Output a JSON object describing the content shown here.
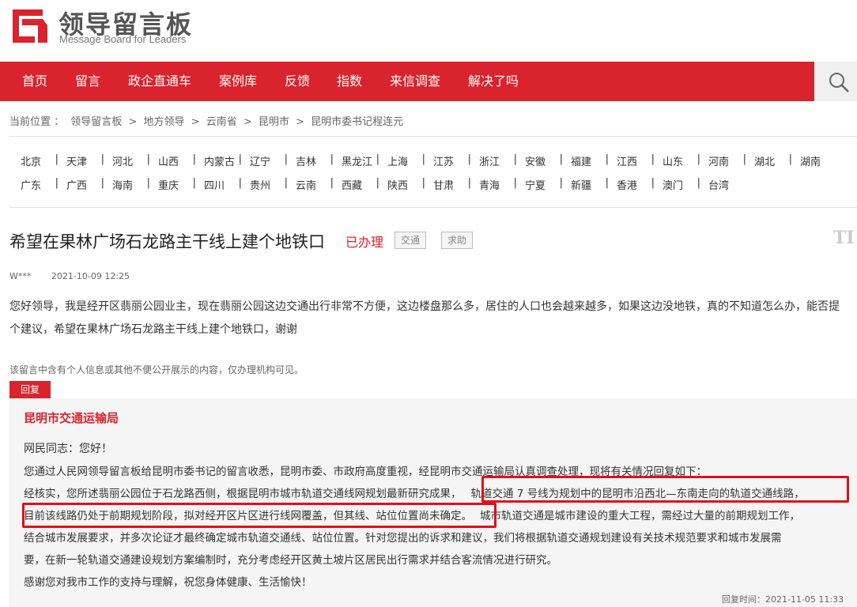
{
  "brand": {
    "title": "领导留言板",
    "subtitle": "Message Board for Leaders"
  },
  "nav": [
    "首页",
    "留言",
    "政企直通车",
    "案例库",
    "反馈",
    "指数",
    "来信调查",
    "解决了吗"
  ],
  "breadcrumb": {
    "prefix": "当前位置 ：",
    "items": [
      "领导留言板",
      "地方领导",
      "云南省",
      "昆明市",
      "昆明市委书记程连元"
    ],
    "separator": ">"
  },
  "regions": {
    "row1": [
      "北京",
      "天津",
      "河北",
      "山西",
      "内蒙古",
      "辽宁",
      "吉林",
      "黑龙江",
      "上海",
      "江苏",
      "浙江",
      "安徽",
      "福建",
      "江西",
      "山东",
      "河南",
      "湖北",
      "湖南"
    ],
    "row2": [
      "广东",
      "广西",
      "海南",
      "重庆",
      "四川",
      "贵州",
      "云南",
      "西藏",
      "陕西",
      "甘肃",
      "青海",
      "宁夏",
      "新疆",
      "香港",
      "澳门",
      "台湾"
    ]
  },
  "message": {
    "title": "希望在果林广场石龙路主干线上建个地铁口",
    "status": "已办理",
    "tags": [
      "交通",
      "求助"
    ],
    "font_toggle": "TI",
    "author": "W***",
    "date": "2021-10-09 12:25",
    "body_line1": "您好领导，我是经开区翡丽公园业主，现在翡丽公园这边交通出行非常不方便，这边楼盘那么多，居住的人口也会越来越多，如果这边没地铁，真的不知道怎么办，能否提",
    "body_line2": "个建议，希望在果林广场石龙路主干线上建个地铁口，谢谢",
    "notice": "该留言中含有个人信息或其他不便公开展示的内容，仅办理机构可见。"
  },
  "reply": {
    "label": "回复",
    "org": "昆明市交通运输局",
    "greeting": "网民同志：您好！",
    "line1": "您通过人民网领导留言板给昆明市委书记的留言收悉，昆明市委、市政府高度重视，经昆明市交通运输局认真调查处理，现将有关情况回复如下：",
    "line2a": "经核实，您所述翡丽公园位于石龙路西侧，根据昆明市城市轨道交通线网规划最新研究成果，",
    "line2b": "轨道交通 7 号线为规划中的昆明市沿西北—东南走向的轨道交通线路，",
    "line3a": "目前该线路仍处于前期规划阶段，拟对经开区片区进行线网覆盖，但其线、站位位置尚未确定。",
    "line3b": "城市轨道交通是城市建设的重大工程，需经过大量的前期规划工作，",
    "line4": "结合城市发展要求，并多次论证才最终确定城市轨道交通线、站位位置。针对您提出的诉求和建议，我们将根据轨道交通规划建设有关技术规范要求和城市发展需",
    "line5": "要，在新一轮轨道交通建设规划方案编制时，充分考虑经开区黄土坡片区居民出行需求并结合客流情况进行研究。",
    "closing": "感谢您对我市工作的支持与理解，祝您身体健康、生活愉快！",
    "time_label": "回复时间：",
    "time": "2021-11-05 11:33"
  },
  "colors": {
    "accent": "#d9232d",
    "highlight": "#e0101a"
  },
  "icons": {
    "logo": "logo-icon",
    "search": "search-icon",
    "font": "font-size-icon"
  }
}
